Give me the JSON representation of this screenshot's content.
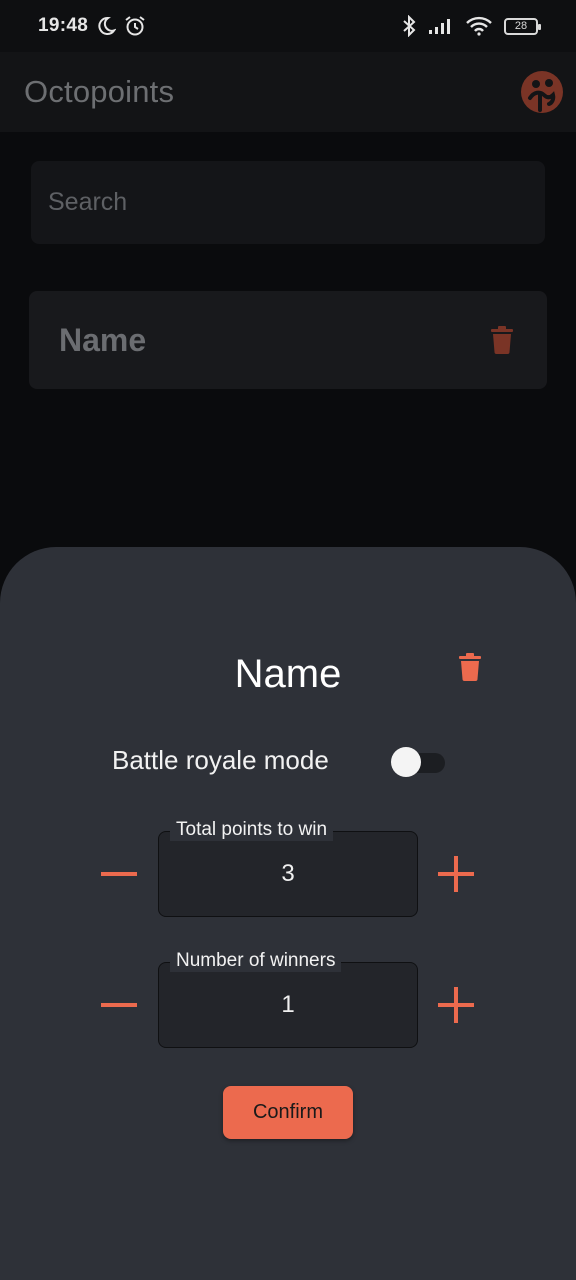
{
  "status_bar": {
    "time": "19:48",
    "battery": "28",
    "icons": [
      "moon-icon",
      "alarm-icon",
      "bluetooth-icon",
      "signal-icon",
      "wifi-icon",
      "battery-icon"
    ]
  },
  "app_bar": {
    "title": "Octopoints",
    "logo_icon": "octopus-logo-icon"
  },
  "search": {
    "placeholder": "Search"
  },
  "list": {
    "items": [
      {
        "name": "Name",
        "icon": "trash-icon"
      }
    ]
  },
  "sheet": {
    "title": "Name",
    "delete_icon": "trash-icon",
    "battle_royale_label": "Battle royale mode",
    "battle_royale_enabled": false,
    "total_points": {
      "label": "Total points to win",
      "value": "3"
    },
    "winners": {
      "label": "Number of winners",
      "value": "1"
    },
    "confirm_label": "Confirm"
  },
  "colors": {
    "accent": "#EC6A4E",
    "sheet_background": "#2E3138",
    "background": "#0A0B0D"
  }
}
